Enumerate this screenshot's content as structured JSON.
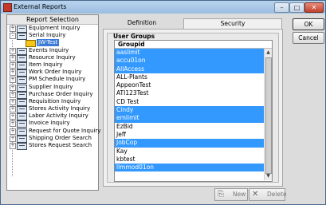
{
  "window": {
    "title": "External Reports"
  },
  "left_panel": {
    "header": "Report Selection",
    "tree": [
      {
        "label": "Equipment Inquiry",
        "expander": "+"
      },
      {
        "label": "Serial Inquiry",
        "expander": "-"
      },
      {
        "label": "JW-Test",
        "child": true
      },
      {
        "label": "Events Inquiry",
        "expander": "+"
      },
      {
        "label": "Resource Inquiry",
        "expander": "+"
      },
      {
        "label": "Item Inquiry",
        "expander": "+"
      },
      {
        "label": "Work Order Inquiry",
        "expander": "+"
      },
      {
        "label": "PM Schedule Inquiry",
        "expander": "+"
      },
      {
        "label": "Supplier Inquiry",
        "expander": "+"
      },
      {
        "label": "Purchase Order Inquiry",
        "expander": "+"
      },
      {
        "label": "Requisition Inquiry",
        "expander": "+"
      },
      {
        "label": "Stores Activity Inquiry",
        "expander": "+"
      },
      {
        "label": "Labor Activity Inquiry",
        "expander": "+"
      },
      {
        "label": "Invoice Inquiry",
        "expander": "+"
      },
      {
        "label": "Request for Quote Inquiry",
        "expander": "+"
      },
      {
        "label": "Shipping Order Search",
        "expander": "+"
      },
      {
        "label": "Stores Request Search",
        "expander": "+"
      }
    ]
  },
  "tabs": {
    "definition": "Definition",
    "security": "Security",
    "active": "Security"
  },
  "user_groups": {
    "title": "User Groups",
    "column_header": "Groupid",
    "rows": [
      {
        "label": "aaslimit",
        "selected": true
      },
      {
        "label": "accu01on",
        "selected": true
      },
      {
        "label": "AllAccess",
        "selected": true
      },
      {
        "label": "ALL-Plants",
        "selected": false
      },
      {
        "label": "AppeonTest",
        "selected": false
      },
      {
        "label": "ATI123Test",
        "selected": false
      },
      {
        "label": "CD Test",
        "selected": false
      },
      {
        "label": "Cindy",
        "selected": true
      },
      {
        "label": "emlimit",
        "selected": true
      },
      {
        "label": "EzBid",
        "selected": false
      },
      {
        "label": "Jeff",
        "selected": false
      },
      {
        "label": "JobCop",
        "selected": true
      },
      {
        "label": "Kay",
        "selected": false
      },
      {
        "label": "kbtest",
        "selected": false
      },
      {
        "label": "llmmod01on",
        "selected": true
      }
    ]
  },
  "buttons": {
    "ok": "OK",
    "cancel": "Cancel",
    "new": "New",
    "delete": "Delete"
  },
  "icons": {
    "app": "app-icon",
    "new": "new-icon",
    "delete": "delete-icon"
  },
  "colors": {
    "selection": "#3399ff",
    "titlebar": "#b9d3ee"
  }
}
